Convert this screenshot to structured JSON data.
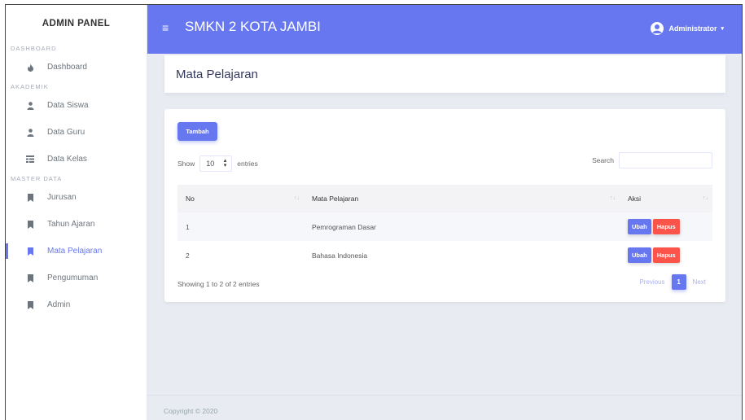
{
  "sidebar": {
    "brand": "ADMIN PANEL",
    "sections": {
      "dashboard": "DASHBOARD",
      "akademik": "AKADEMIK",
      "master": "MASTER DATA"
    },
    "items": {
      "dashboard": "Dashboard",
      "data_siswa": "Data Siswa",
      "data_guru": "Data Guru",
      "data_kelas": "Data Kelas",
      "jurusan": "Jurusan",
      "tahun_ajaran": "Tahun Ajaran",
      "mata_pelajaran": "Mata Pelajaran",
      "pengumuman": "Pengumuman",
      "admin": "Admin"
    }
  },
  "header": {
    "menu_icon": "≡",
    "title": "SMKN 2 KOTA JAMBI",
    "user": "Administrator",
    "caret": "▾"
  },
  "page": {
    "title": "Mata Pelajaran",
    "add_button": "Tambah",
    "show_label": "Show",
    "entries_value": "10",
    "entries_label": "entries",
    "search_label": "Search",
    "columns": {
      "no": "No",
      "mapel": "Mata Pelajaran",
      "aksi": "Aksi"
    },
    "rows": [
      {
        "no": "1",
        "mapel": "Pemrograman Dasar",
        "edit": "Ubah",
        "delete": "Hapus"
      },
      {
        "no": "2",
        "mapel": "Bahasa Indonesia",
        "edit": "Ubah",
        "delete": "Hapus"
      }
    ],
    "info": "Showing 1 to 2 of 2 entries",
    "pagination": {
      "previous": "Previous",
      "current": "1",
      "next": "Next"
    }
  },
  "footer": {
    "text": "Copyright © 2020"
  },
  "colors": {
    "primary": "#6777ef",
    "danger": "#fc544b"
  }
}
